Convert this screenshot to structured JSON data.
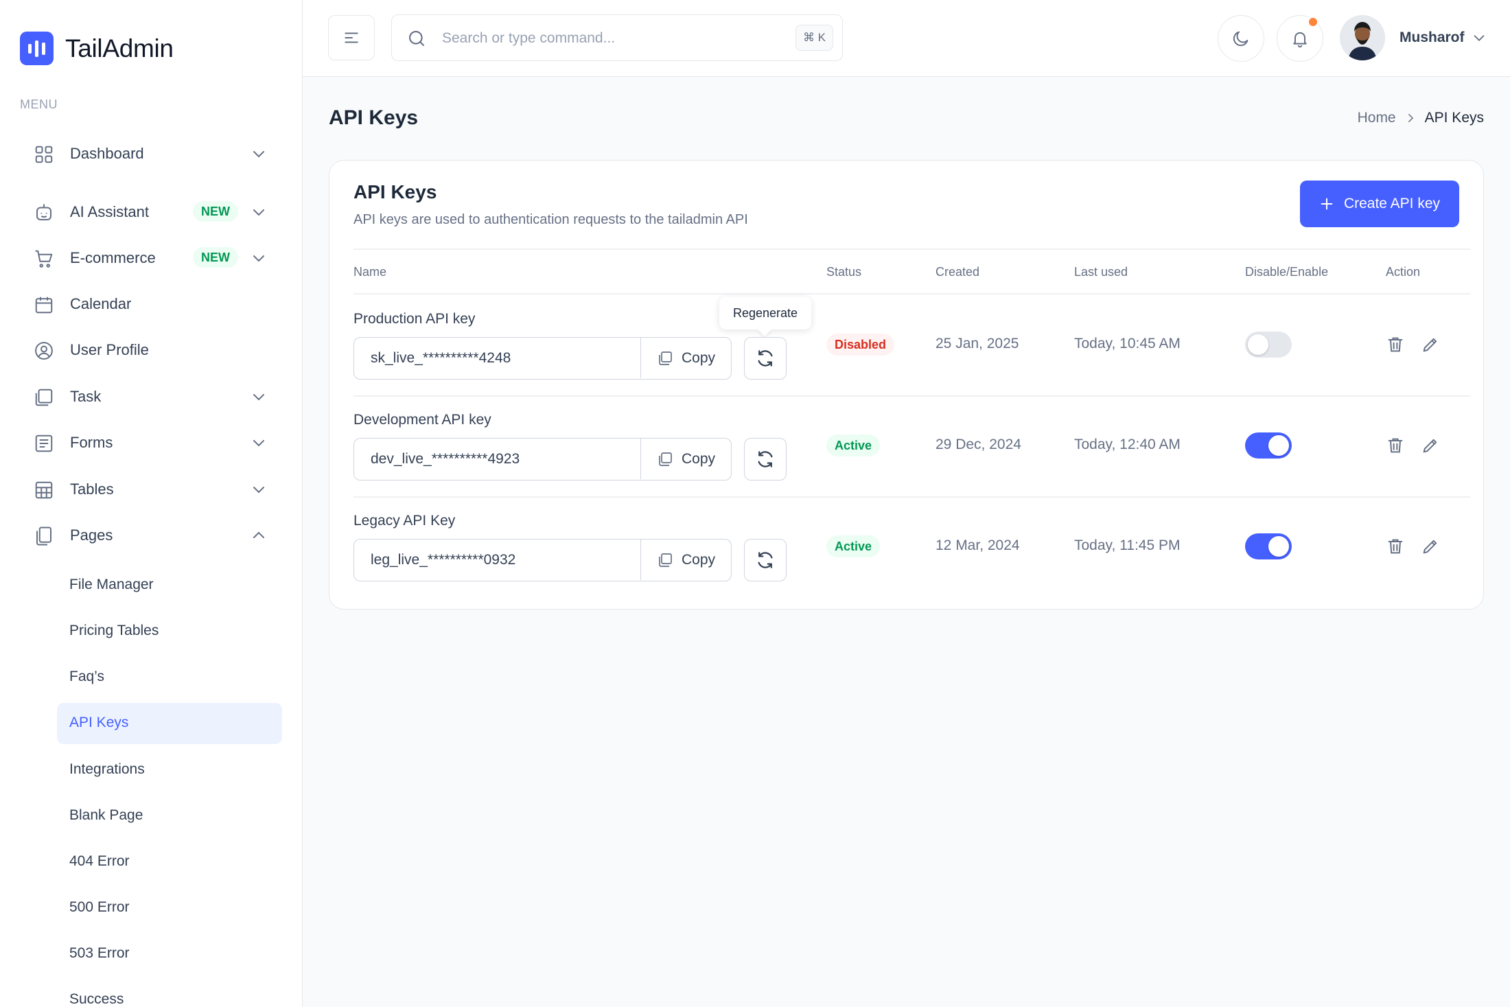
{
  "app": {
    "name": "TailAdmin",
    "accent": "#465fff"
  },
  "sidebar": {
    "menu_label": "MENU",
    "items": [
      {
        "label": "Dashboard",
        "icon": "grid-icon"
      },
      {
        "label": "AI Assistant",
        "icon": "robot-icon",
        "badge": "NEW"
      },
      {
        "label": "E-commerce",
        "icon": "cart-icon",
        "badge": "NEW"
      },
      {
        "label": "Calendar",
        "icon": "calendar-icon"
      },
      {
        "label": "User Profile",
        "icon": "user-circle-icon"
      },
      {
        "label": "Task",
        "icon": "task-icon"
      },
      {
        "label": "Forms",
        "icon": "form-icon"
      },
      {
        "label": "Tables",
        "icon": "table-icon"
      },
      {
        "label": "Pages",
        "icon": "pages-icon"
      }
    ],
    "sub_items": [
      {
        "label": "File Manager"
      },
      {
        "label": "Pricing Tables"
      },
      {
        "label": "Faq’s"
      },
      {
        "label": "API Keys",
        "active": true
      },
      {
        "label": "Integrations"
      },
      {
        "label": "Blank Page"
      },
      {
        "label": "404 Error"
      },
      {
        "label": "500 Error"
      },
      {
        "label": "503 Error"
      },
      {
        "label": "Success"
      }
    ]
  },
  "header": {
    "search_placeholder": "Search or type command...",
    "shortcut": "⌘ K",
    "user_name": "Musharof"
  },
  "page": {
    "title": "API Keys",
    "breadcrumb": {
      "home": "Home",
      "current": "API Keys"
    }
  },
  "card": {
    "title": "API Keys",
    "subtitle": "API keys are used to authentication requests to the tailadmin API",
    "create_button": "Create API key",
    "columns": {
      "name": "Name",
      "status": "Status",
      "created": "Created",
      "last_used": "Last used",
      "toggle": "Disable/Enable",
      "action": "Action"
    },
    "tooltip": "Regenerate",
    "copy_label": "Copy",
    "rows": [
      {
        "name": "Production API key",
        "key": "sk_live_**********4248",
        "status": "Disabled",
        "created": "25 Jan, 2025",
        "last_used": "Today, 10:45 AM",
        "enabled": false
      },
      {
        "name": "Development API key",
        "key": "dev_live_**********4923",
        "status": "Active",
        "created": "29 Dec, 2024",
        "last_used": "Today, 12:40 AM",
        "enabled": true
      },
      {
        "name": "Legacy API Key",
        "key": "leg_live_**********0932",
        "status": "Active",
        "created": "12 Mar, 2024",
        "last_used": "Today, 11:45 PM",
        "enabled": true
      }
    ]
  }
}
